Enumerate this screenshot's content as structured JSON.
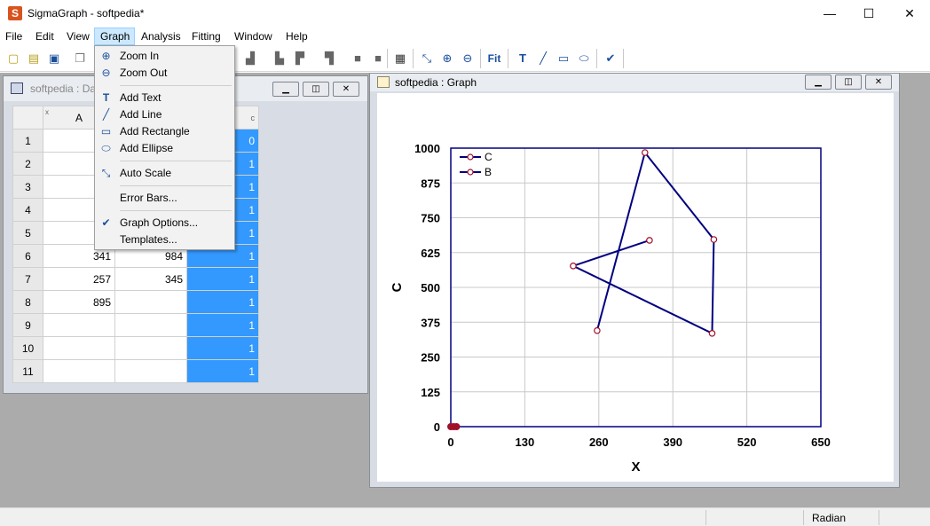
{
  "app": {
    "title": "SigmaGraph - softpedia*",
    "icon_letter": "S"
  },
  "window_controls": {
    "minimize": "—",
    "maximize": "☐",
    "close": "✕"
  },
  "menubar": [
    "File",
    "Edit",
    "View",
    "Graph",
    "Analysis",
    "Fitting",
    "Window",
    "Help"
  ],
  "graph_menu": {
    "items": [
      {
        "label": "Zoom In",
        "icon": "zoom-in-icon"
      },
      {
        "label": "Zoom Out",
        "icon": "zoom-out-icon"
      },
      {
        "label": "Add Text",
        "icon": "text-icon"
      },
      {
        "label": "Add Line",
        "icon": "line-icon"
      },
      {
        "label": "Add Rectangle",
        "icon": "rectangle-icon"
      },
      {
        "label": "Add Ellipse",
        "icon": "ellipse-icon"
      },
      {
        "label": "Auto Scale",
        "icon": "autoscale-icon"
      },
      {
        "label": "Error Bars...",
        "icon": ""
      },
      {
        "label": "Graph Options...",
        "icon": "check-icon"
      },
      {
        "label": "Templates...",
        "icon": ""
      }
    ]
  },
  "data_window": {
    "title": "softpedia : Dat",
    "headers": {
      "corner": "",
      "col_x_tag": "x",
      "col_a": "A",
      "col_c_tag": "c"
    },
    "rows": [
      {
        "n": "1",
        "a": "",
        "b": "",
        "c": "0"
      },
      {
        "n": "2",
        "a": "",
        "b": "",
        "c": "1"
      },
      {
        "n": "3",
        "a": "",
        "b": "",
        "c": "1"
      },
      {
        "n": "4",
        "a": "",
        "b": "",
        "c": "1"
      },
      {
        "n": "5",
        "a": "",
        "b": "",
        "c": "1"
      },
      {
        "n": "6",
        "a": "341",
        "b": "984",
        "c": "1"
      },
      {
        "n": "7",
        "a": "257",
        "b": "345",
        "c": "1"
      },
      {
        "n": "8",
        "a": "895",
        "b": "",
        "c": "1"
      },
      {
        "n": "9",
        "a": "",
        "b": "",
        "c": "1"
      },
      {
        "n": "10",
        "a": "",
        "b": "",
        "c": "1"
      },
      {
        "n": "11",
        "a": "",
        "b": "",
        "c": "1"
      }
    ]
  },
  "graph_window": {
    "title": "softpedia : Graph"
  },
  "statusbar": {
    "mode": "Radian"
  },
  "colors": {
    "series": "#000080",
    "marker": "#a0102a",
    "selection": "#3399ff"
  },
  "chart_data": {
    "type": "line",
    "xlabel": "X",
    "ylabel": "C",
    "xlim": [
      0,
      650
    ],
    "ylim": [
      0,
      1000
    ],
    "xticks": [
      "0",
      "130",
      "260",
      "390",
      "520",
      "650"
    ],
    "yticks": [
      "0",
      "125",
      "250",
      "375",
      "500",
      "625",
      "750",
      "875",
      "1000"
    ],
    "legend": [
      "C",
      "B"
    ],
    "legend_placement": "top-left",
    "grid": true,
    "series": [
      {
        "name": "C",
        "x": [
          257,
          341,
          462,
          459,
          215,
          349
        ],
        "y": [
          345,
          984,
          672,
          335,
          577,
          669
        ]
      },
      {
        "name": "B",
        "x": [
          0,
          5,
          10
        ],
        "y": [
          0,
          0,
          0
        ]
      }
    ]
  }
}
